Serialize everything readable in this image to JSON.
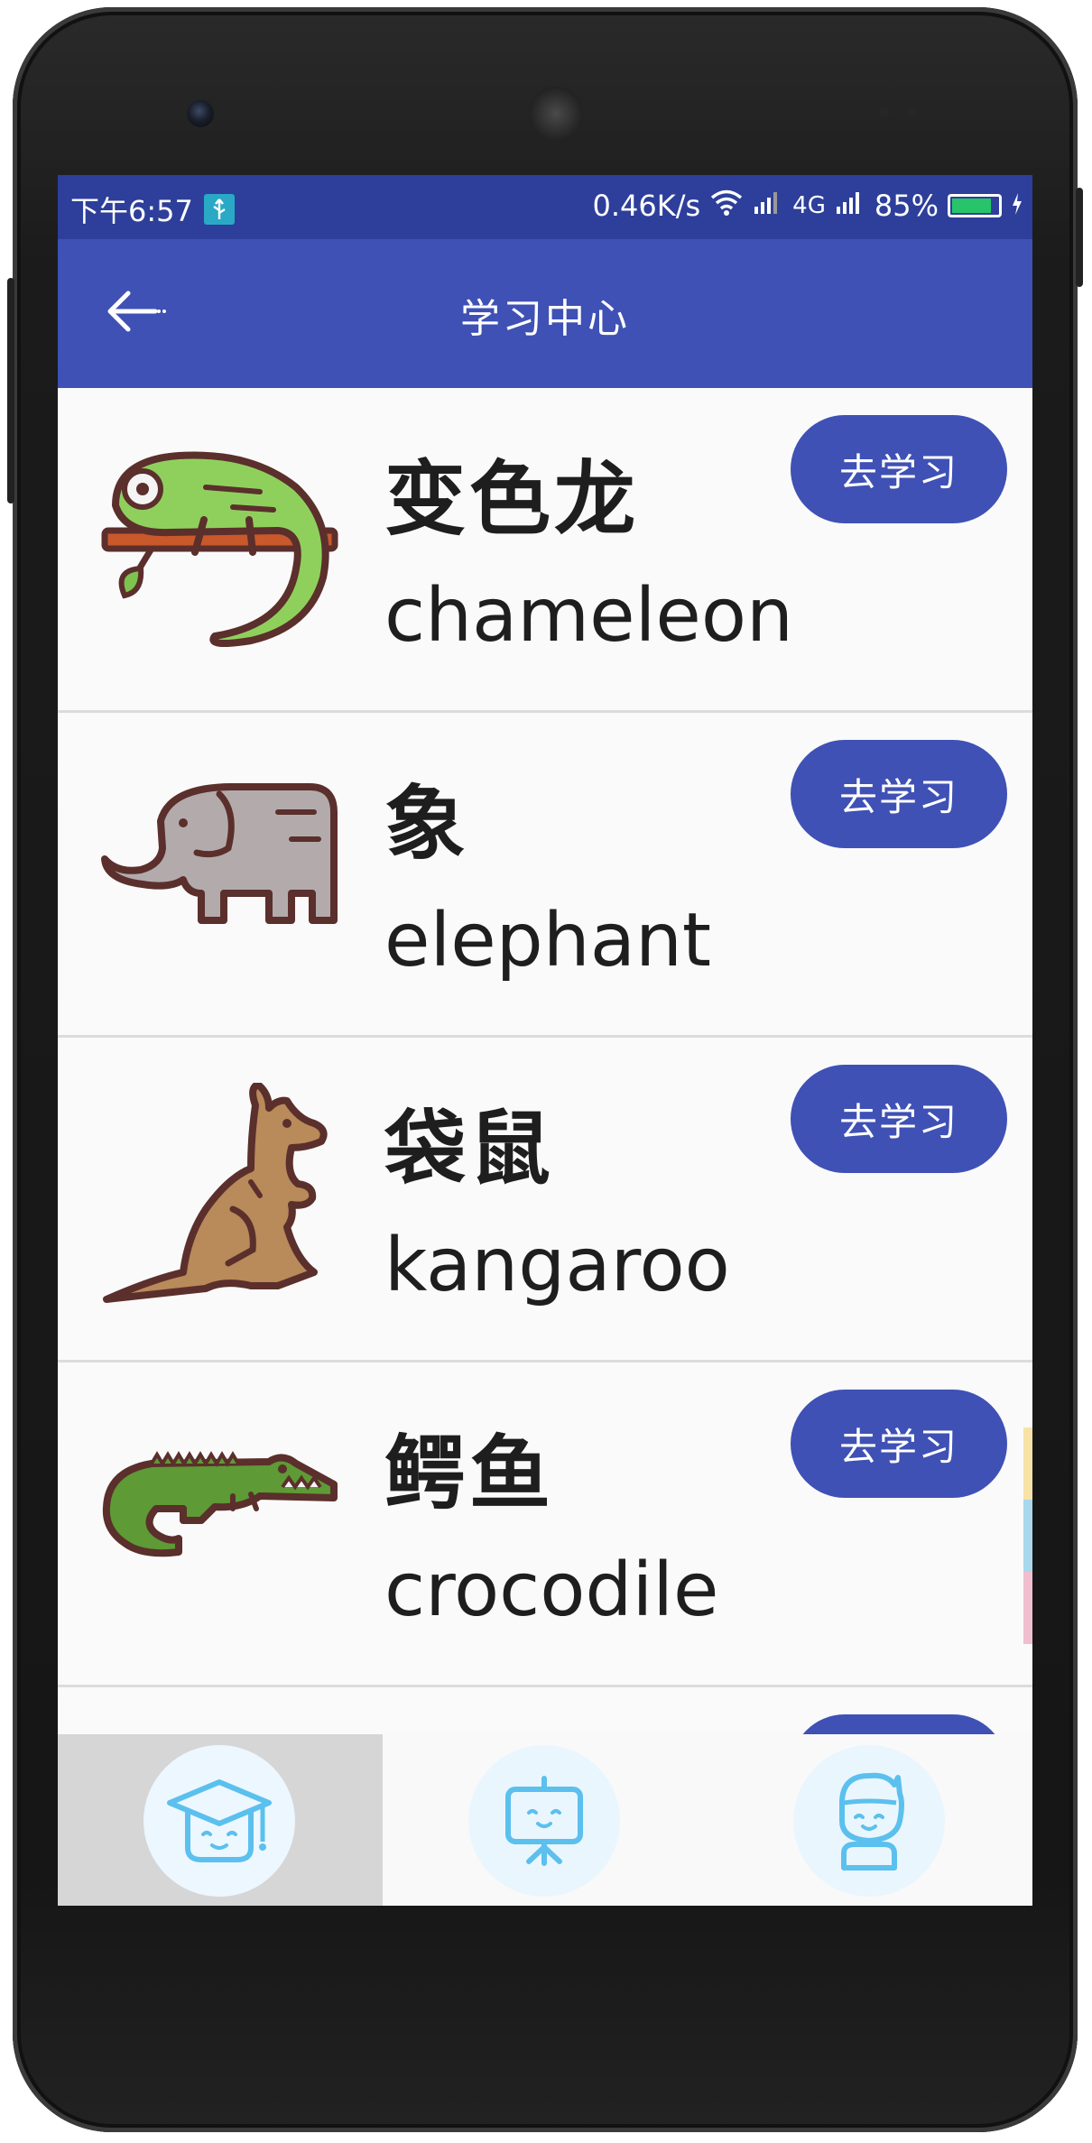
{
  "status_bar": {
    "time": "下午6:57",
    "speed": "0.46K/s",
    "network": "4G",
    "battery": "85%",
    "battery_level": 0.85
  },
  "app_bar": {
    "title": "学习中心",
    "back_icon": "arrow-left-icon"
  },
  "colors": {
    "primary": "#3f51b5",
    "status_bar": "#2d3f9a",
    "nav_icon": "#5bc0ee"
  },
  "items": [
    {
      "cn": "变色龙",
      "en": "chameleon",
      "button": "去学习",
      "icon": "chameleon-icon"
    },
    {
      "cn": "象",
      "en": "elephant",
      "button": "去学习",
      "icon": "elephant-icon"
    },
    {
      "cn": "袋鼠",
      "en": "kangaroo",
      "button": "去学习",
      "icon": "kangaroo-icon"
    },
    {
      "cn": "鳄鱼",
      "en": "crocodile",
      "button": "去学习",
      "icon": "crocodile-icon"
    }
  ],
  "bottom_nav": [
    {
      "icon": "graduation-cap-icon",
      "active": true
    },
    {
      "icon": "presentation-board-icon",
      "active": false
    },
    {
      "icon": "user-profile-icon",
      "active": false
    }
  ]
}
